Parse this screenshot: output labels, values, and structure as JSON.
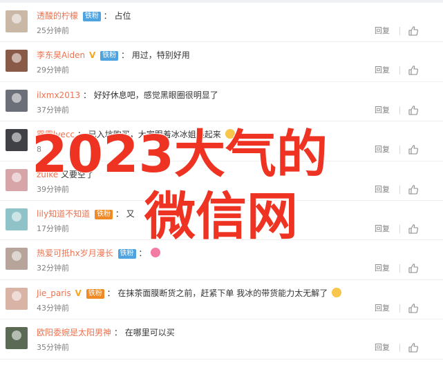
{
  "watermark": {
    "line1": "2023大气的",
    "line2": "微信网"
  },
  "actions": {
    "reply_label": "回复",
    "like_icon": "thumbs-up-icon"
  },
  "comments": [
    {
      "user": "透酸的柠檬",
      "vip": false,
      "badge": "铁粉",
      "badge_type": "blue",
      "sep": "：",
      "text": "占位",
      "time": "25分钟前",
      "avatar_color": "#c9b8a6"
    },
    {
      "user": "李东昊Aiden",
      "vip": true,
      "badge": "铁粉",
      "badge_type": "blue",
      "sep": "：",
      "text": "用过，特别好用",
      "time": "29分钟前",
      "avatar_color": "#8a5a48"
    },
    {
      "user": "ilxmx2013",
      "vip": false,
      "badge": "",
      "badge_type": "",
      "sep": "：",
      "text": "好好休息吧，感觉黑眼圈很明显了",
      "time": "37分钟前",
      "avatar_color": "#6b6f78"
    },
    {
      "user": "露露lvecc",
      "vip": false,
      "badge": "",
      "badge_type": "",
      "sep": "：",
      "text": "已入坑购买，大家跟着冰冰姐美起来",
      "time": "8",
      "avatar_color": "#3f4146"
    },
    {
      "user": "zuike",
      "vip": false,
      "badge": "",
      "badge_type": "",
      "sep": "",
      "text": "又要空了",
      "time": "39分钟前",
      "avatar_color": "#d7a4a7"
    },
    {
      "user": "lily知道不知道",
      "vip": false,
      "badge": "铁粉",
      "badge_type": "gold",
      "sep": "：",
      "text": "又",
      "time": "17分钟前",
      "avatar_color": "#8fc3c8"
    },
    {
      "user": "热爱可抵hx岁月漫长",
      "vip": false,
      "badge": "铁粉",
      "badge_type": "blue",
      "sep": "：",
      "text": "",
      "time": "32分钟前",
      "avatar_color": "#b7a49a"
    },
    {
      "user": "Jie_paris",
      "vip": true,
      "badge": "铁粉",
      "badge_type": "gold",
      "sep": "：",
      "text": "在抹茶面膜断货之前，赶紧下单 我冰的带货能力太无解了",
      "time": "43分钟前",
      "avatar_color": "#d9b3a6"
    },
    {
      "user": "欧阳委婉是太阳男神",
      "vip": false,
      "badge": "",
      "badge_type": "",
      "sep": "：",
      "text": "在哪里可以买",
      "time": "35分钟前",
      "avatar_color": "#5b6a55"
    }
  ]
}
